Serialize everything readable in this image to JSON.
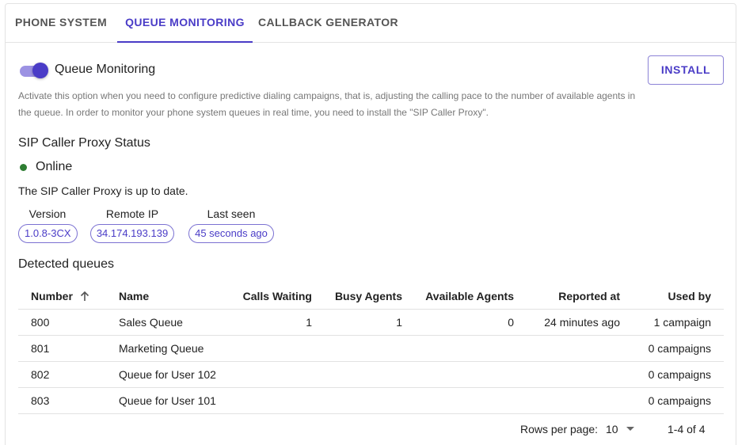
{
  "tabs": [
    {
      "label": "PHONE SYSTEM",
      "active": false
    },
    {
      "label": "QUEUE MONITORING",
      "active": true
    },
    {
      "label": "CALLBACK GENERATOR",
      "active": false
    }
  ],
  "monitoring": {
    "toggle_on": true,
    "title": "Queue Monitoring",
    "install_label": "INSTALL",
    "description": "Activate this option when you need to configure predictive dialing campaigns, that is, adjusting the calling pace to the number of available agents in the queue. In order to monitor your phone system queues in real time, you need to install the \"SIP Caller Proxy\"."
  },
  "proxy": {
    "section_title": "SIP Caller Proxy Status",
    "status": "Online",
    "status_color": "#2e7d32",
    "message": "The SIP Caller Proxy is up to date.",
    "info": [
      {
        "label": "Version",
        "value": "1.0.8-3CX"
      },
      {
        "label": "Remote IP",
        "value": "34.174.193.139"
      },
      {
        "label": "Last seen",
        "value": "45 seconds ago"
      }
    ]
  },
  "queues": {
    "section_title": "Detected queues",
    "columns": [
      "Number",
      "Name",
      "Calls Waiting",
      "Busy Agents",
      "Available Agents",
      "Reported at",
      "Used by"
    ],
    "sort_icon": "arrow-up-icon",
    "rows": [
      [
        "800",
        "Sales Queue",
        "1",
        "1",
        "0",
        "24 minutes ago",
        "1 campaign"
      ],
      [
        "801",
        "Marketing Queue",
        "",
        "",
        "",
        "",
        "0 campaigns"
      ],
      [
        "802",
        "Queue for User 102",
        "",
        "",
        "",
        "",
        "0 campaigns"
      ],
      [
        "803",
        "Queue for User 101",
        "",
        "",
        "",
        "",
        "0 campaigns"
      ]
    ]
  },
  "pagination": {
    "rows_per_page_label": "Rows per page:",
    "rows_per_page": "10",
    "range": "1-4 of 4"
  },
  "colors": {
    "accent": "#4a3cc7",
    "online": "#2e7d32"
  }
}
